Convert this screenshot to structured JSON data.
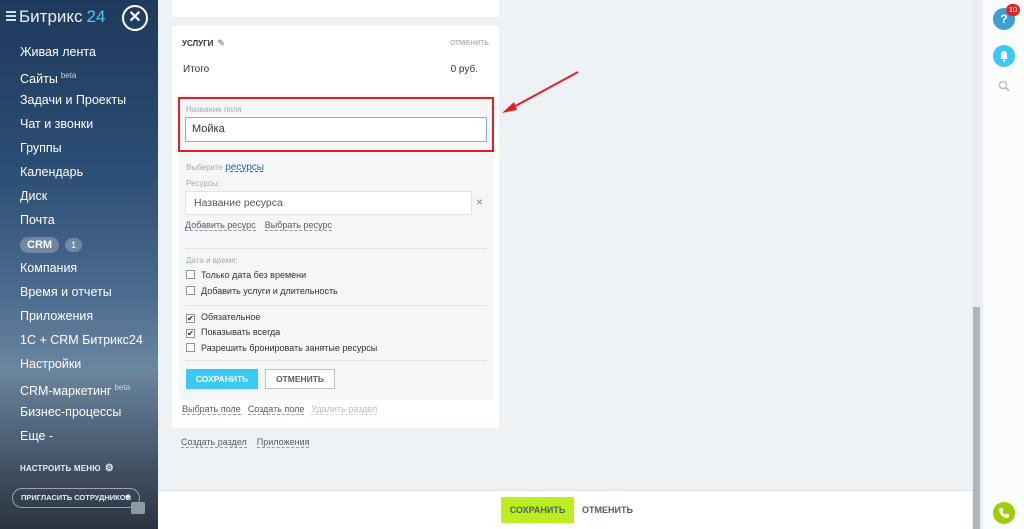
{
  "sidebar": {
    "logo_main": "Битрикс",
    "logo_num": "24",
    "items": [
      {
        "label": "Живая лента",
        "sup": ""
      },
      {
        "label": "Сайты",
        "sup": "beta"
      },
      {
        "label": "Задачи и Проекты",
        "sup": ""
      },
      {
        "label": "Чат и звонки",
        "sup": ""
      },
      {
        "label": "Группы",
        "sup": ""
      },
      {
        "label": "Календарь",
        "sup": ""
      },
      {
        "label": "Диск",
        "sup": ""
      },
      {
        "label": "Почта",
        "sup": ""
      },
      {
        "label": "CRM",
        "sup": "",
        "count": "1"
      },
      {
        "label": "Компания",
        "sup": ""
      },
      {
        "label": "Время и отчеты",
        "sup": ""
      },
      {
        "label": "Приложения",
        "sup": ""
      },
      {
        "label": "1С + CRM Битрикс24",
        "sup": ""
      },
      {
        "label": "Настройки",
        "sup": ""
      },
      {
        "label": "CRM-маркетинг",
        "sup": "beta"
      },
      {
        "label": "Бизнес-процессы",
        "sup": ""
      },
      {
        "label": "Еще -",
        "sup": ""
      }
    ],
    "config_menu": "НАСТРОИТЬ МЕНЮ",
    "invite": "ПРИГЛАСИТЬ СОТРУДНИКОВ"
  },
  "card": {
    "header": "УСЛУГИ",
    "cancel": "отменить",
    "total_label": "Итого",
    "total_value": "0 руб.",
    "field_name_label": "Название поля",
    "field_name_value": "Мойка",
    "choose_prefix": "Выберите",
    "choose_link": "ресурсы",
    "resources_label": "Ресурсы:",
    "resource_placeholder": "Название ресурса",
    "add_resource": "Добавить ресурс",
    "select_resource": "Выбрать ресурс",
    "datetime_label": "Дата и время:",
    "checkboxes": [
      {
        "label": "Только дата без времени",
        "checked": false
      },
      {
        "label": "Добавить услуги и длительность",
        "checked": false
      },
      {
        "label": "Обязательное",
        "checked": true
      },
      {
        "label": "Показывать всегда",
        "checked": true
      },
      {
        "label": "Разрешить бронировать занятые ресурсы",
        "checked": false
      }
    ],
    "save": "СОХРАНИТЬ",
    "cancel_btn": "ОТМЕНИТЬ",
    "select_field": "Выбрать поле",
    "create_field": "Создать поле",
    "delete_section": "Удалить раздел"
  },
  "bottom_links": {
    "create_section": "Создать раздел",
    "apps": "Приложения"
  },
  "rightbar": {
    "help_badge": "10"
  },
  "bottombar": {
    "save": "СОХРАНИТЬ",
    "cancel": "ОТМЕНИТЬ"
  },
  "colors": {
    "accent_blue": "#3bc8f5",
    "save_green": "#bbed21",
    "highlight_red": "#e31e24"
  }
}
